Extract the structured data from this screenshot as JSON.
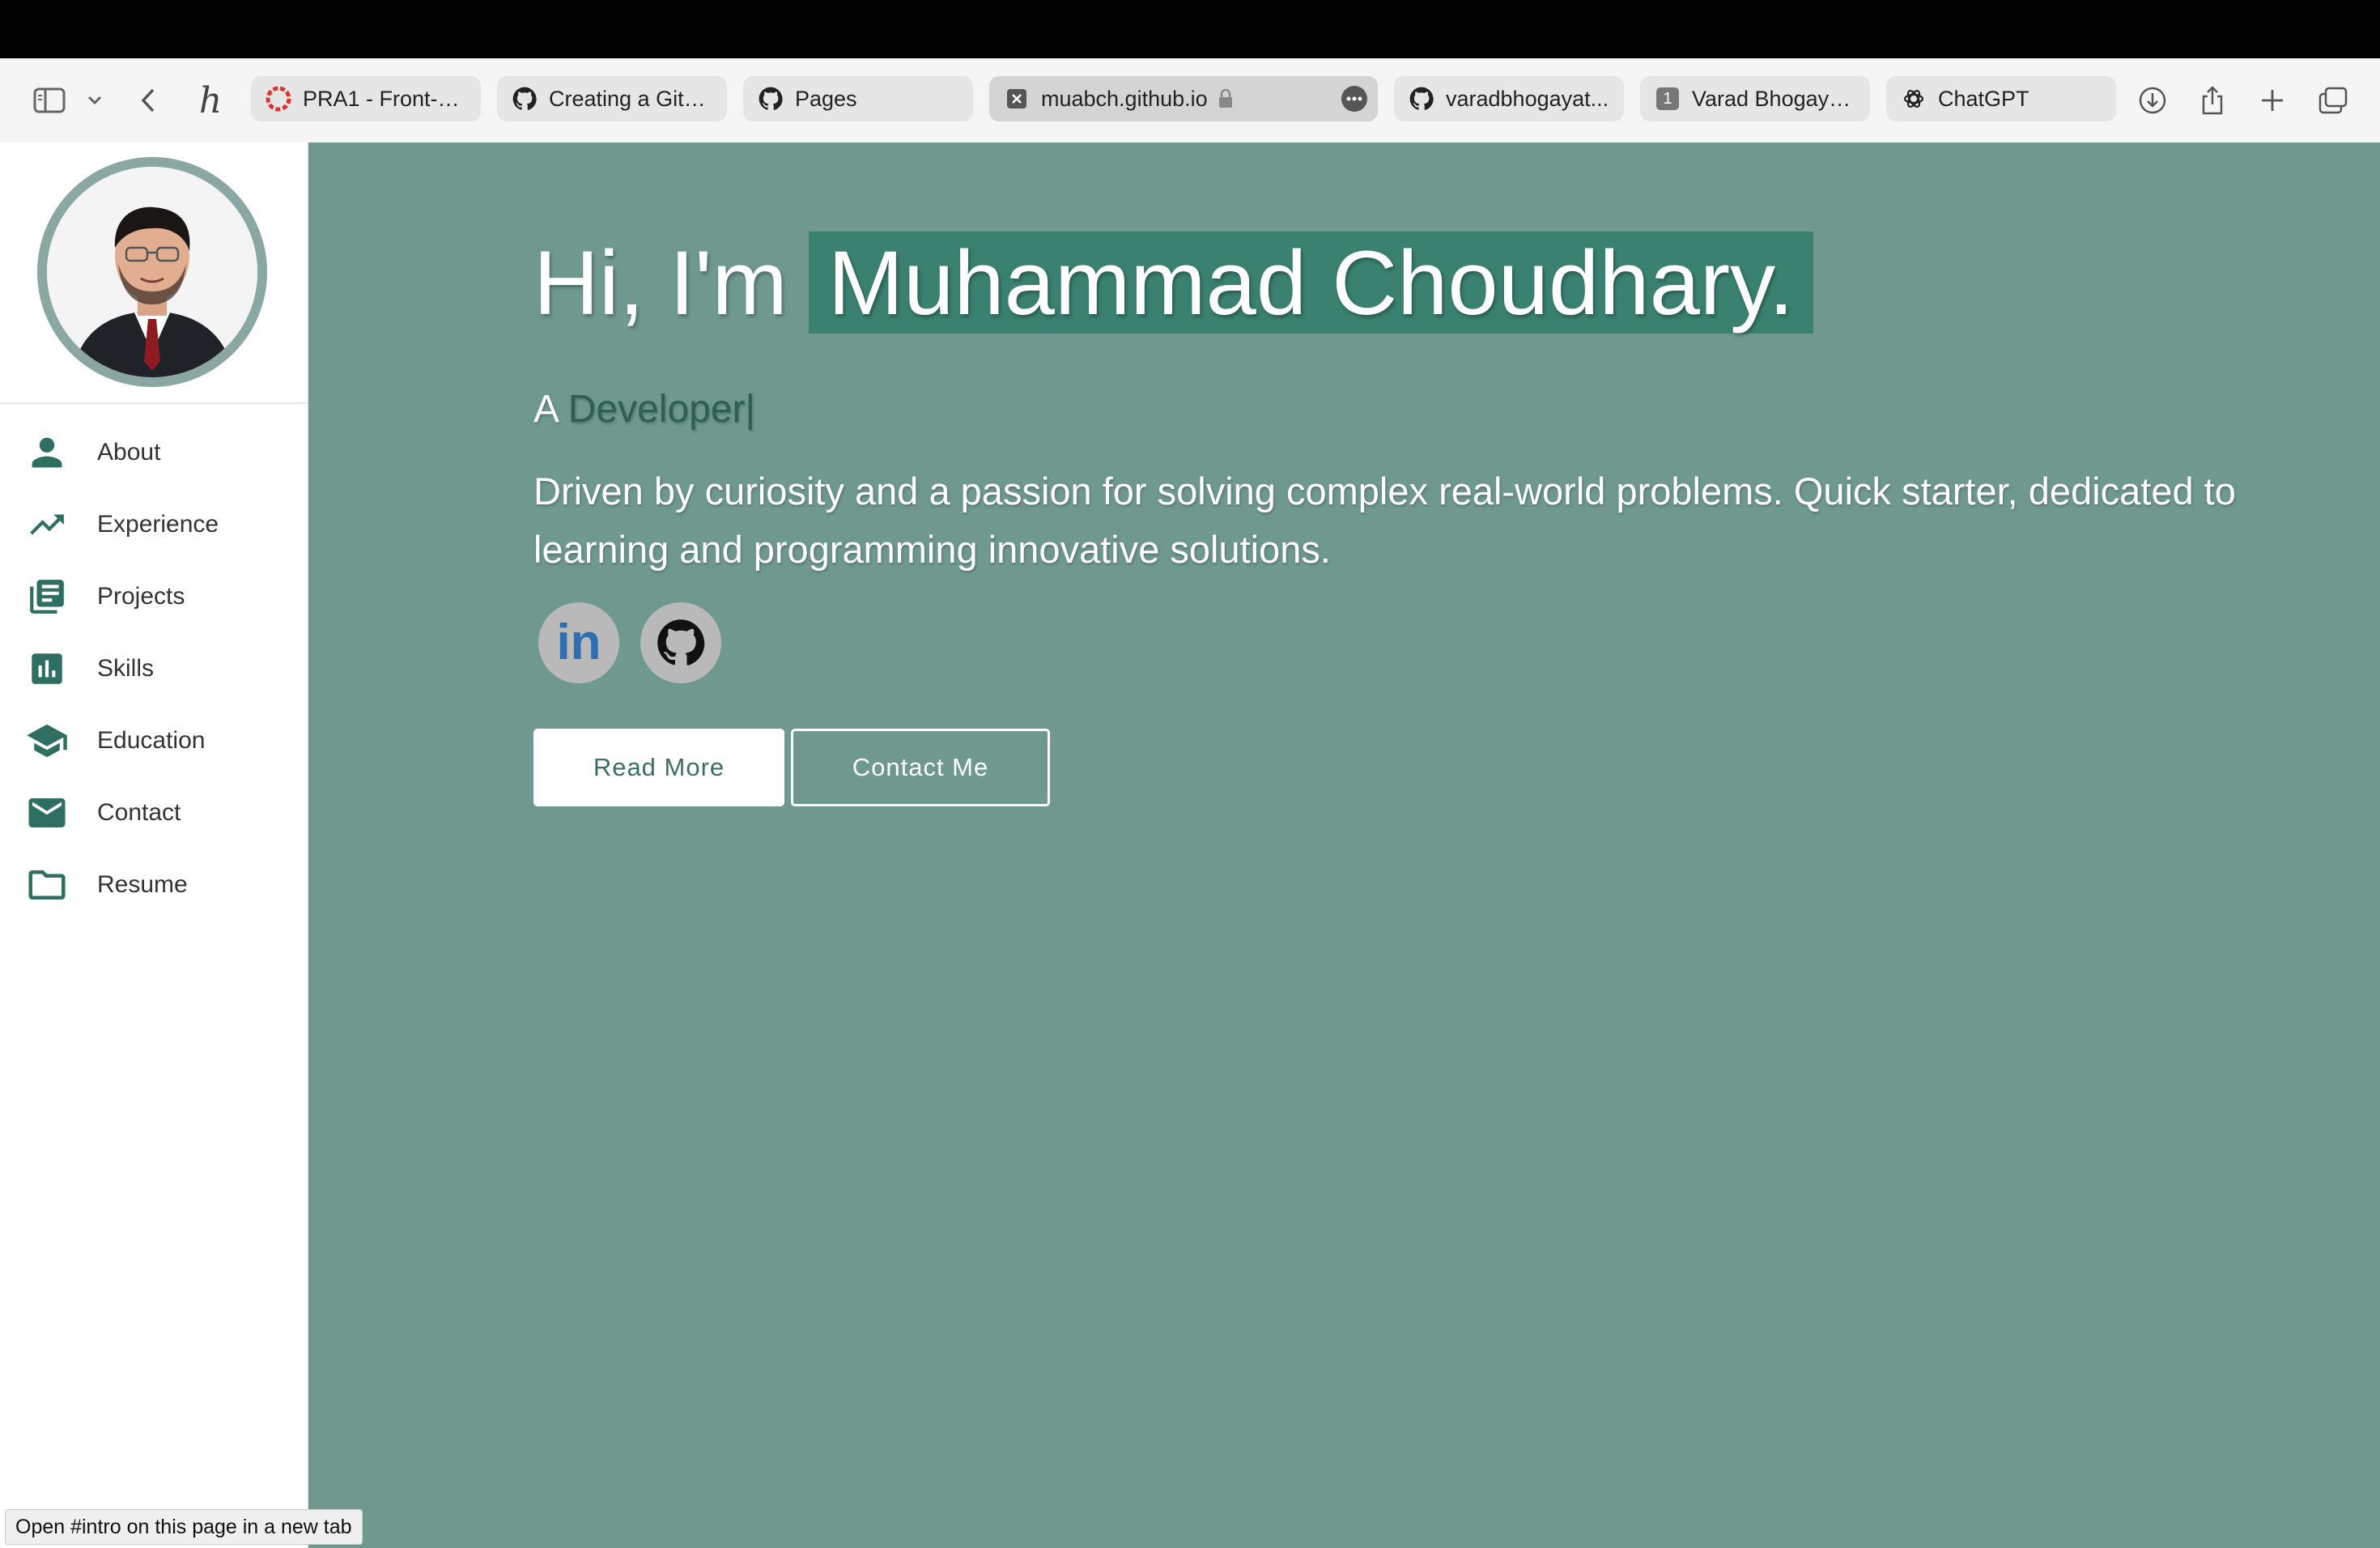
{
  "browser": {
    "tabs": [
      {
        "label": "PRA1 - Front-e...",
        "icon": "pra-favicon"
      },
      {
        "label": "Creating a GitH...",
        "icon": "github-icon"
      },
      {
        "label": "Pages",
        "icon": "github-icon"
      },
      {
        "label": "muabch.github.io",
        "icon": "close-tab-icon",
        "active": true
      },
      {
        "label": "varadbhogayat...",
        "icon": "github-icon"
      },
      {
        "label": "Varad Bhogaya...",
        "icon": "number-badge-icon",
        "badge": "1"
      },
      {
        "label": "ChatGPT",
        "icon": "chatgpt-icon"
      }
    ],
    "status_text": "Open #intro on this page in a new tab"
  },
  "sidebar": {
    "items": [
      {
        "label": "About",
        "icon": "person-icon"
      },
      {
        "label": "Experience",
        "icon": "trending-up-icon"
      },
      {
        "label": "Projects",
        "icon": "library-books-icon"
      },
      {
        "label": "Skills",
        "icon": "bar-chart-icon"
      },
      {
        "label": "Education",
        "icon": "school-icon"
      },
      {
        "label": "Contact",
        "icon": "email-icon"
      },
      {
        "label": "Resume",
        "icon": "folder-icon"
      }
    ]
  },
  "hero": {
    "greeting": "Hi, I'm",
    "name": "Muhammad Choudhary.",
    "role_prefix": "A",
    "role": "Developer|",
    "description": "Driven by curiosity and a passion for solving complex real-world problems. Quick starter, dedicated to learning and programming innovative solutions.",
    "social": [
      {
        "icon": "linkedin-icon",
        "text": "in"
      },
      {
        "icon": "github-icon"
      }
    ],
    "buttons": {
      "read_more": "Read More",
      "contact": "Contact Me"
    }
  },
  "colors": {
    "main_bg": "#6f998f",
    "name_highlight": "#3a8170",
    "accent": "#2e6f62"
  }
}
